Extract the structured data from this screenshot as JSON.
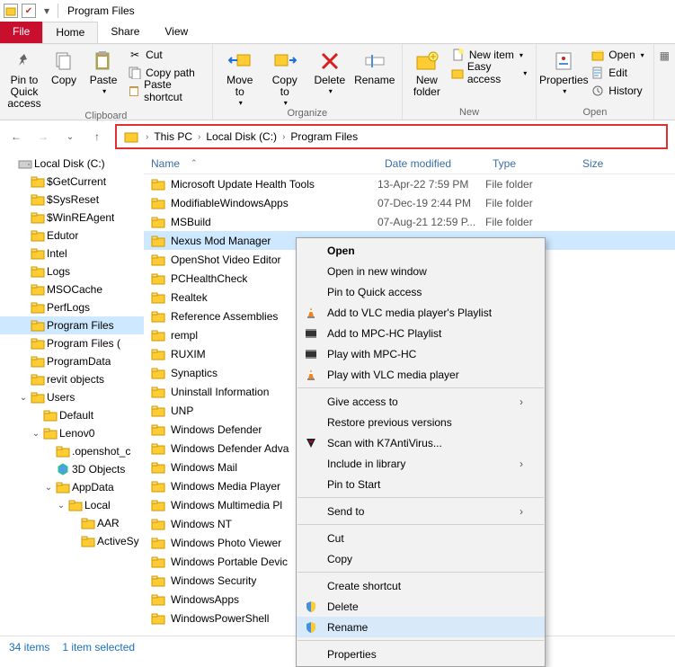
{
  "window": {
    "title": "Program Files"
  },
  "qat": {
    "down_icon": "▾",
    "check": "✔"
  },
  "tabs": {
    "file": "File",
    "home": "Home",
    "share": "Share",
    "view": "View"
  },
  "ribbon": {
    "pin": "Pin to Quick\naccess",
    "copy": "Copy",
    "paste": "Paste",
    "cut": "Cut",
    "copypath": "Copy path",
    "pasteshortcut": "Paste shortcut",
    "clipboard": "Clipboard",
    "moveto": "Move\nto",
    "copyto": "Copy\nto",
    "delete": "Delete",
    "rename": "Rename",
    "organize": "Organize",
    "newfolder": "New\nfolder",
    "newitem": "New item",
    "easyaccess": "Easy access",
    "new": "New",
    "properties": "Properties",
    "open": "Open",
    "edit": "Edit",
    "history": "History",
    "opengrp": "Open"
  },
  "breadcrumb": {
    "items": [
      "This PC",
      "Local Disk (C:)",
      "Program Files"
    ]
  },
  "tree": [
    {
      "depth": 0,
      "tw": "",
      "icon": "drive",
      "label": "Local Disk (C:)"
    },
    {
      "depth": 1,
      "tw": "",
      "icon": "folder",
      "label": "$GetCurrent"
    },
    {
      "depth": 1,
      "tw": "",
      "icon": "folder",
      "label": "$SysReset"
    },
    {
      "depth": 1,
      "tw": "",
      "icon": "folder",
      "label": "$WinREAgent"
    },
    {
      "depth": 1,
      "tw": "",
      "icon": "folder",
      "label": "Edutor"
    },
    {
      "depth": 1,
      "tw": "",
      "icon": "folder",
      "label": "Intel"
    },
    {
      "depth": 1,
      "tw": "",
      "icon": "folder",
      "label": "Logs"
    },
    {
      "depth": 1,
      "tw": "",
      "icon": "folder",
      "label": "MSOCache"
    },
    {
      "depth": 1,
      "tw": "",
      "icon": "folder",
      "label": "PerfLogs"
    },
    {
      "depth": 1,
      "tw": "",
      "icon": "folder",
      "label": "Program Files",
      "sel": true
    },
    {
      "depth": 1,
      "tw": "",
      "icon": "folder",
      "label": "Program Files ("
    },
    {
      "depth": 1,
      "tw": "",
      "icon": "folder",
      "label": "ProgramData"
    },
    {
      "depth": 1,
      "tw": "",
      "icon": "folder",
      "label": "revit objects"
    },
    {
      "depth": 1,
      "tw": "⌄",
      "icon": "folder",
      "label": "Users"
    },
    {
      "depth": 2,
      "tw": "",
      "icon": "folder",
      "label": "Default"
    },
    {
      "depth": 2,
      "tw": "⌄",
      "icon": "folder",
      "label": "Lenov0"
    },
    {
      "depth": 3,
      "tw": "",
      "icon": "folder",
      "label": ".openshot_c"
    },
    {
      "depth": 3,
      "tw": "",
      "icon": "3d",
      "label": "3D Objects"
    },
    {
      "depth": 3,
      "tw": "⌄",
      "icon": "folder",
      "label": "AppData"
    },
    {
      "depth": 4,
      "tw": "⌄",
      "icon": "folder",
      "label": "Local"
    },
    {
      "depth": 5,
      "tw": "",
      "icon": "folder",
      "label": "AAR"
    },
    {
      "depth": 5,
      "tw": "",
      "icon": "folder",
      "label": "ActiveSy"
    }
  ],
  "columns": {
    "name": "Name",
    "date": "Date modified",
    "type": "Type",
    "size": "Size"
  },
  "rows": [
    {
      "name": "Microsoft Update Health Tools",
      "date": "13-Apr-22 7:59 PM",
      "type": "File folder"
    },
    {
      "name": "ModifiableWindowsApps",
      "date": "07-Dec-19 2:44 PM",
      "type": "File folder"
    },
    {
      "name": "MSBuild",
      "date": "07-Aug-21 12:59 P...",
      "type": "File folder"
    },
    {
      "name": "Nexus Mod Manager",
      "date": "",
      "type": "",
      "sel": true
    },
    {
      "name": "OpenShot Video Editor",
      "date": "",
      "type": ""
    },
    {
      "name": "PCHealthCheck",
      "date": "",
      "type": ""
    },
    {
      "name": "Realtek",
      "date": "",
      "type": ""
    },
    {
      "name": "Reference Assemblies",
      "date": "",
      "type": ""
    },
    {
      "name": "rempl",
      "date": "",
      "type": ""
    },
    {
      "name": "RUXIM",
      "date": "",
      "type": ""
    },
    {
      "name": "Synaptics",
      "date": "",
      "type": ""
    },
    {
      "name": "Uninstall Information",
      "date": "",
      "type": ""
    },
    {
      "name": "UNP",
      "date": "",
      "type": ""
    },
    {
      "name": "Windows Defender",
      "date": "",
      "type": ""
    },
    {
      "name": "Windows Defender Adva",
      "date": "",
      "type": ""
    },
    {
      "name": "Windows Mail",
      "date": "",
      "type": ""
    },
    {
      "name": "Windows Media Player",
      "date": "",
      "type": ""
    },
    {
      "name": "Windows Multimedia Pl",
      "date": "",
      "type": ""
    },
    {
      "name": "Windows NT",
      "date": "",
      "type": ""
    },
    {
      "name": "Windows Photo Viewer",
      "date": "",
      "type": ""
    },
    {
      "name": "Windows Portable Devic",
      "date": "",
      "type": ""
    },
    {
      "name": "Windows Security",
      "date": "",
      "type": ""
    },
    {
      "name": "WindowsApps",
      "date": "",
      "type": ""
    },
    {
      "name": "WindowsPowerShell",
      "date": "",
      "type": ""
    }
  ],
  "ctx": [
    {
      "bold": true,
      "label": "Open"
    },
    {
      "label": "Open in new window"
    },
    {
      "label": "Pin to Quick access"
    },
    {
      "icon": "vlc",
      "label": "Add to VLC media player's Playlist"
    },
    {
      "icon": "mpc",
      "label": "Add to MPC-HC Playlist"
    },
    {
      "icon": "mpc",
      "label": "Play with MPC-HC"
    },
    {
      "icon": "vlc",
      "label": "Play with VLC media player"
    },
    {
      "sep": true
    },
    {
      "label": "Give access to",
      "sub": true
    },
    {
      "label": "Restore previous versions"
    },
    {
      "icon": "k7",
      "label": "Scan with K7AntiVirus..."
    },
    {
      "label": "Include in library",
      "sub": true
    },
    {
      "label": "Pin to Start"
    },
    {
      "sep": true
    },
    {
      "label": "Send to",
      "sub": true
    },
    {
      "sep": true
    },
    {
      "label": "Cut"
    },
    {
      "label": "Copy"
    },
    {
      "sep": true
    },
    {
      "label": "Create shortcut"
    },
    {
      "icon": "shield",
      "label": "Delete"
    },
    {
      "icon": "shield",
      "label": "Rename",
      "hov": true
    },
    {
      "sep": true
    },
    {
      "label": "Properties"
    }
  ],
  "status": {
    "items": "34 items",
    "selected": "1 item selected"
  }
}
